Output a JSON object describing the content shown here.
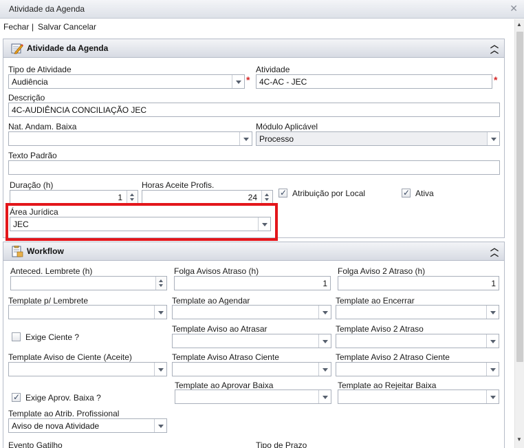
{
  "window": {
    "title": "Atividade da Agenda"
  },
  "toolbar": {
    "fechar": "Fechar",
    "separator": "|",
    "salvar": "Salvar",
    "cancelar": "Cancelar"
  },
  "panel1": {
    "title": "Atividade da Agenda",
    "tipo_label": "Tipo de Atividade",
    "tipo_value": "Audiência",
    "atividade_label": "Atividade",
    "atividade_value": "4C-AC - JEC",
    "descricao_label": "Descrição",
    "descricao_value": "4C-AUDIÊNCIA CONCILIAÇÃO JEC",
    "nat_label": "Nat. Andam. Baixa",
    "nat_value": "",
    "modulo_label": "Módulo Aplicável",
    "modulo_value": "Processo",
    "texto_label": "Texto Padrão",
    "texto_value": "",
    "duracao_label": "Duração (h)",
    "duracao_value": "1",
    "horas_label": "Horas Aceite Profis.",
    "horas_value": "24",
    "atribuicao_label": "Atribuição por Local",
    "ativa_label": "Ativa",
    "area_label": "Área Jurídica",
    "area_value": "JEC",
    "required_mark": "*"
  },
  "panel2": {
    "title": "Workflow",
    "anteced_label": "Anteced. Lembrete (h)",
    "anteced_value": "",
    "folga_label": "Folga Avisos Atraso (h)",
    "folga_value": "1",
    "folga2_label": "Folga Aviso 2 Atraso (h)",
    "folga2_value": "1",
    "tpl_lembrete_label": "Template p/ Lembrete",
    "tpl_agendar_label": "Template ao Agendar",
    "tpl_encerrar_label": "Template ao Encerrar",
    "exige_ciente_label": "Exige Ciente ?",
    "tpl_aviso_atrasar_label": "Template Aviso ao Atrasar",
    "tpl_aviso2_label": "Template Aviso 2 Atraso",
    "tpl_aviso_ciente_label": "Template Aviso de Ciente (Aceite)",
    "tpl_atraso_ciente_label": "Template Aviso Atraso Ciente",
    "tpl_aviso2_ciente_label": "Template Aviso 2 Atraso Ciente",
    "exige_aprov_label": "Exige Aprov. Baixa ?",
    "tpl_aprovar_label": "Template ao Aprovar Baixa",
    "tpl_rejeitar_label": "Template ao Rejeitar Baixa",
    "tpl_atrib_label": "Template ao Atrib. Profissional",
    "tpl_atrib_value": "Aviso de nova Atividade",
    "evento_label": "Evento Gatilho",
    "tipo_prazo_label": "Tipo de Prazo"
  },
  "colors": {
    "highlight": "#e3161b",
    "required": "#d62828",
    "panel_border": "#b6bcc8"
  }
}
